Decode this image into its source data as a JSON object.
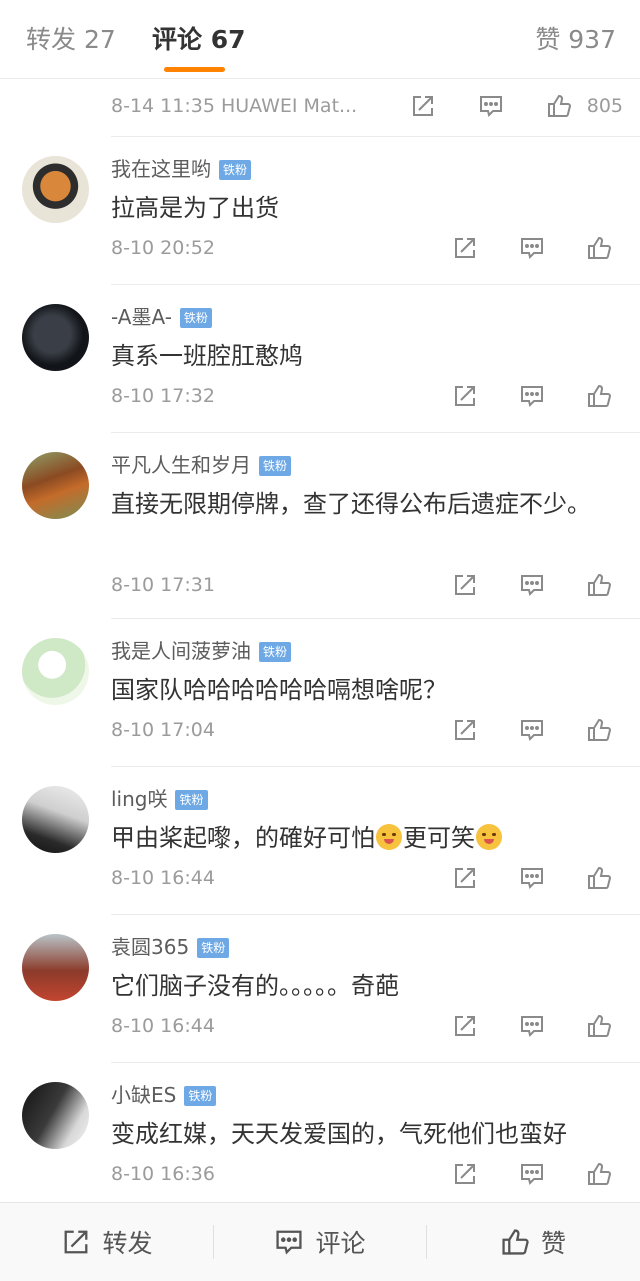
{
  "tabs": {
    "repost_label": "转发 27",
    "comments_label": "评论 67",
    "likes_label": "赞 937",
    "active": "comments",
    "accent_color": "#ff8200"
  },
  "top_comment": {
    "meta": "8-14 11:35  HUAWEI Mat...",
    "like_count": "805"
  },
  "comments": [
    {
      "username": "我在这里哟",
      "badge": "铁粉",
      "text": "拉高是为了出货",
      "time": "8-10 20:52"
    },
    {
      "username": "-A墨A-",
      "badge": "铁粉",
      "text": "真系一班腔肛憨鸠",
      "time": "8-10 17:32"
    },
    {
      "username": "平凡人生和岁月",
      "badge": "铁粉",
      "text": "直接无限期停牌，查了还得公布后遗症不少。",
      "time": "8-10 17:31"
    },
    {
      "username": "我是人间菠萝油",
      "badge": "铁粉",
      "text": "国家队哈哈哈哈哈哈嗝想啥呢？",
      "time": "8-10 17:04"
    },
    {
      "username": "ling咲",
      "badge": "铁粉",
      "text_part1": "甲由桨起嚟，的確好可怕",
      "text_part2": "更可笑",
      "emoji_1": "yum-emoji",
      "emoji_2": "smile-emoji",
      "time": "8-10 16:44"
    },
    {
      "username": "袁圆365",
      "badge": "铁粉",
      "text": "它们脑子没有的。。。。。奇葩",
      "time": "8-10 16:44"
    },
    {
      "username": "小缺ES",
      "badge": "铁粉",
      "text": "变成红媒，天天发爱国的，气死他们也蛮好",
      "time": "8-10 16:36"
    }
  ],
  "bottom_bar": {
    "repost_label": "转发",
    "comment_label": "评论",
    "like_label": "赞"
  },
  "icons": [
    "repost-icon",
    "comment-icon",
    "like-icon"
  ]
}
